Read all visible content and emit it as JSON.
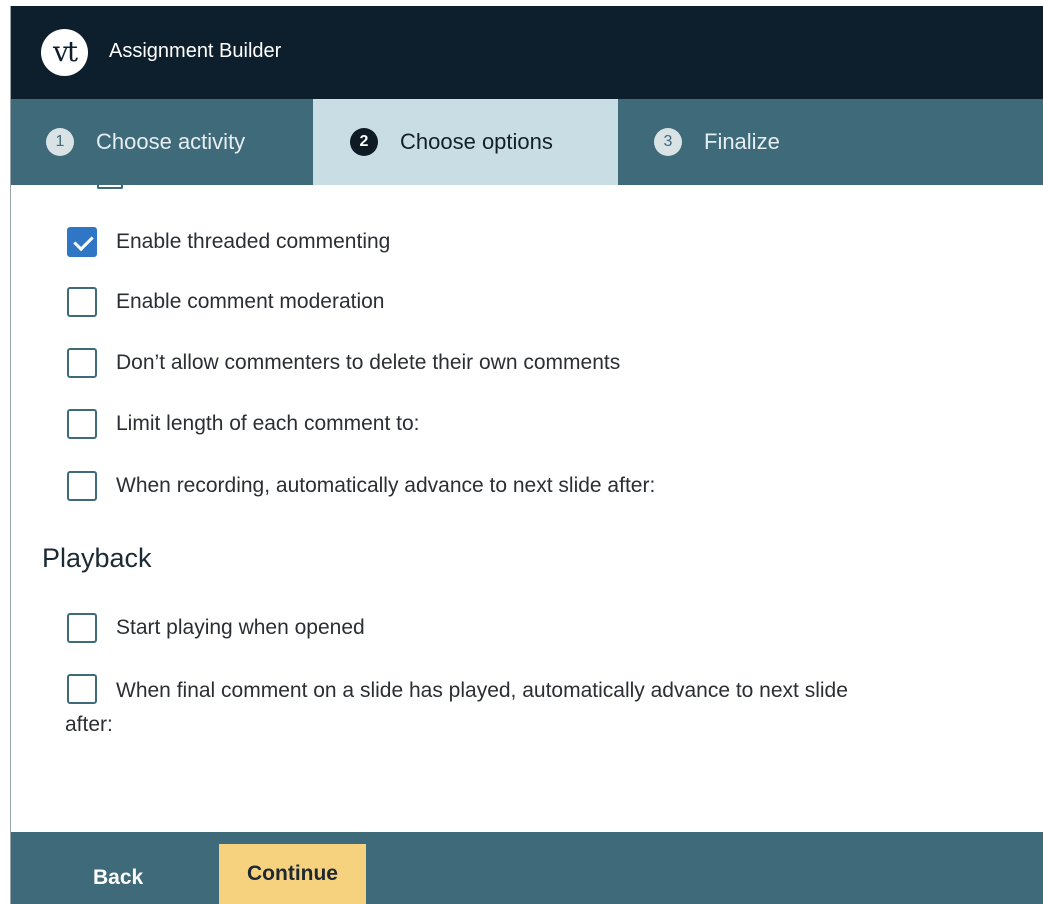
{
  "header": {
    "logo_text": "vt",
    "title": "Assignment Builder"
  },
  "steps": [
    {
      "number": "1",
      "label": "Choose activity",
      "active": false
    },
    {
      "number": "2",
      "label": "Choose options",
      "active": true
    },
    {
      "number": "3",
      "label": "Finalize",
      "active": false
    }
  ],
  "options": [
    {
      "label": "Enable threaded commenting",
      "checked": true
    },
    {
      "label": "Enable comment moderation",
      "checked": false
    },
    {
      "label": "Don’t allow commenters to delete their own comments",
      "checked": false
    },
    {
      "label": "Limit length of each comment to:",
      "checked": false
    },
    {
      "label": "When recording, automatically advance to next slide after:",
      "checked": false
    }
  ],
  "playback": {
    "title": "Playback",
    "options": [
      {
        "label": "Start playing when opened",
        "checked": false
      },
      {
        "label": "When final comment on a slide has played, automatically advance to next slide",
        "continuation": "after:",
        "checked": false
      }
    ]
  },
  "footer": {
    "back_label": "Back",
    "continue_label": "Continue"
  },
  "colors": {
    "header": "#0d1f2c",
    "steps_bar": "#3f6a7a",
    "active_step": "#c9dde4",
    "checkbox_checked": "#2f76c4",
    "continue_button": "#f6d27f"
  }
}
